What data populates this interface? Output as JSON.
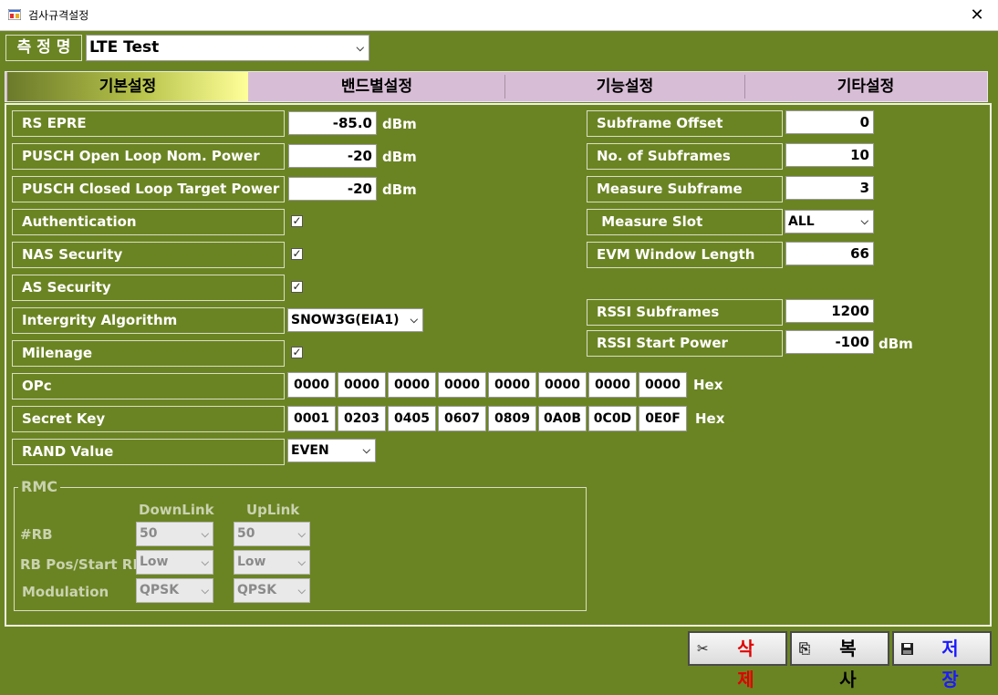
{
  "window": {
    "title": "검사규격설정",
    "close_glyph": "✕"
  },
  "header": {
    "label": "측 정 명",
    "measurement_name": "LTE Test"
  },
  "tabs": [
    "기본설정",
    "밴드별설정",
    "기능설정",
    "기타설정"
  ],
  "left": {
    "rs_epre": {
      "label": "RS EPRE",
      "value": "-85.0",
      "unit": "dBm"
    },
    "pusch_open": {
      "label": "PUSCH Open Loop Nom. Power",
      "value": "-20",
      "unit": "dBm"
    },
    "pusch_closed": {
      "label": "PUSCH Closed Loop Target Power",
      "value": "-20",
      "unit": "dBm"
    },
    "authentication": {
      "label": "Authentication",
      "checked": true
    },
    "nas_security": {
      "label": "NAS Security",
      "checked": true
    },
    "as_security": {
      "label": "AS Security",
      "checked": true
    },
    "integrity": {
      "label": "Intergrity Algorithm",
      "value": "SNOW3G(EIA1)"
    },
    "milenage": {
      "label": "Milenage",
      "checked": true
    },
    "opc": {
      "label": "OPc",
      "values": [
        "0000",
        "0000",
        "0000",
        "0000",
        "0000",
        "0000",
        "0000",
        "0000"
      ],
      "unit": "Hex"
    },
    "secret_key": {
      "label": "Secret Key",
      "values": [
        "0001",
        "0203",
        "0405",
        "0607",
        "0809",
        "0A0B",
        "0C0D",
        "0E0F"
      ],
      "unit": "Hex"
    },
    "rand": {
      "label": "RAND Value",
      "value": "EVEN"
    }
  },
  "right": {
    "subframe_offset": {
      "label": "Subframe Offset",
      "value": "0"
    },
    "no_subframes": {
      "label": "No. of Subframes",
      "value": "10"
    },
    "measure_subframe": {
      "label": "Measure Subframe",
      "value": "3"
    },
    "measure_slot": {
      "label": " Measure Slot",
      "value": "ALL"
    },
    "evm_window": {
      "label": "EVM Window Length",
      "value": "66"
    },
    "rssi_subframes": {
      "label": "RSSI Subframes",
      "value": "1200"
    },
    "rssi_start": {
      "label": "RSSI Start Power",
      "value": "-100",
      "unit": "dBm"
    }
  },
  "rmc": {
    "title": "RMC",
    "downlink_header": "DownLink",
    "uplink_header": "UpLink",
    "rb": {
      "label": "#RB",
      "downlink": "50",
      "uplink": "50"
    },
    "rb_pos": {
      "label": "RB Pos/Start RB",
      "downlink": "Low",
      "uplink": "Low"
    },
    "modulation": {
      "label": "Modulation",
      "downlink": "QPSK",
      "uplink": "QPSK"
    }
  },
  "buttons": {
    "delete": {
      "label": "삭제",
      "color": "#e00000",
      "icon": "scissors-icon"
    },
    "copy": {
      "label": "복사",
      "color": "#000000",
      "icon": "copy-icon"
    },
    "save": {
      "label": "저장",
      "color": "#1a1aff",
      "icon": "floppy-icon"
    }
  },
  "colors": {
    "background": "#6b8423",
    "tab_bar": "#d7bdd5"
  }
}
